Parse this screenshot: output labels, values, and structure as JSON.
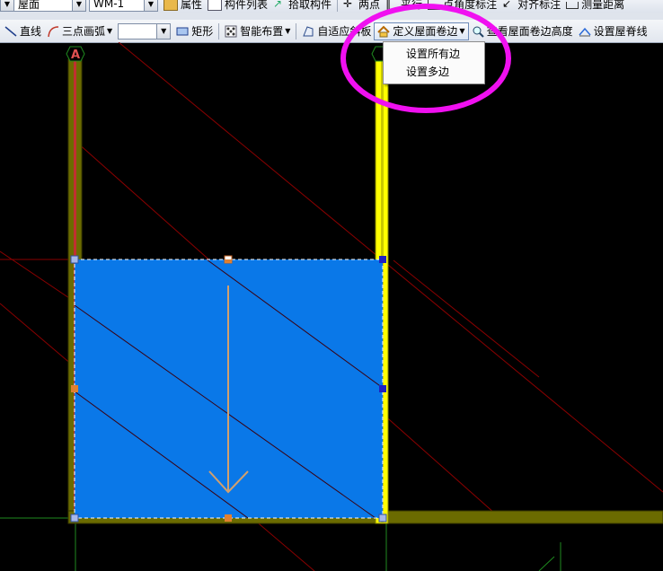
{
  "toolbar_top": {
    "layer_combo": "屋面",
    "component_combo": "WM-1",
    "attr_label": "属性",
    "list_label": "构件列表",
    "pick_label": "拾取构件",
    "twopoint_label": "两点",
    "parallel_label": "平行",
    "angle_label": "点角度标注",
    "align_label": "对齐标注",
    "measure_label": "测量距离"
  },
  "toolbar_draw": {
    "line_label": "直线",
    "arc_label": "三点画弧",
    "combo_value": "",
    "rect_label": "矩形",
    "smart_label": "智能布置",
    "adaptive_label": "自适应斜板",
    "define_edge_label": "定义屋面卷边",
    "view_height_label": "查看屋面卷边高度",
    "ridge_label": "设置屋脊线"
  },
  "dropdown_menu": {
    "items": [
      "设置所有边",
      "设置多边"
    ]
  },
  "canvas": {
    "axis_label": "A",
    "colors": {
      "background": "#000000",
      "slab_fill": "#0a78e8",
      "wall": "#6b6b00",
      "highlight_wall": "#ffff00",
      "arrow": "#d2a06e",
      "annotation": "#f010f0"
    }
  }
}
